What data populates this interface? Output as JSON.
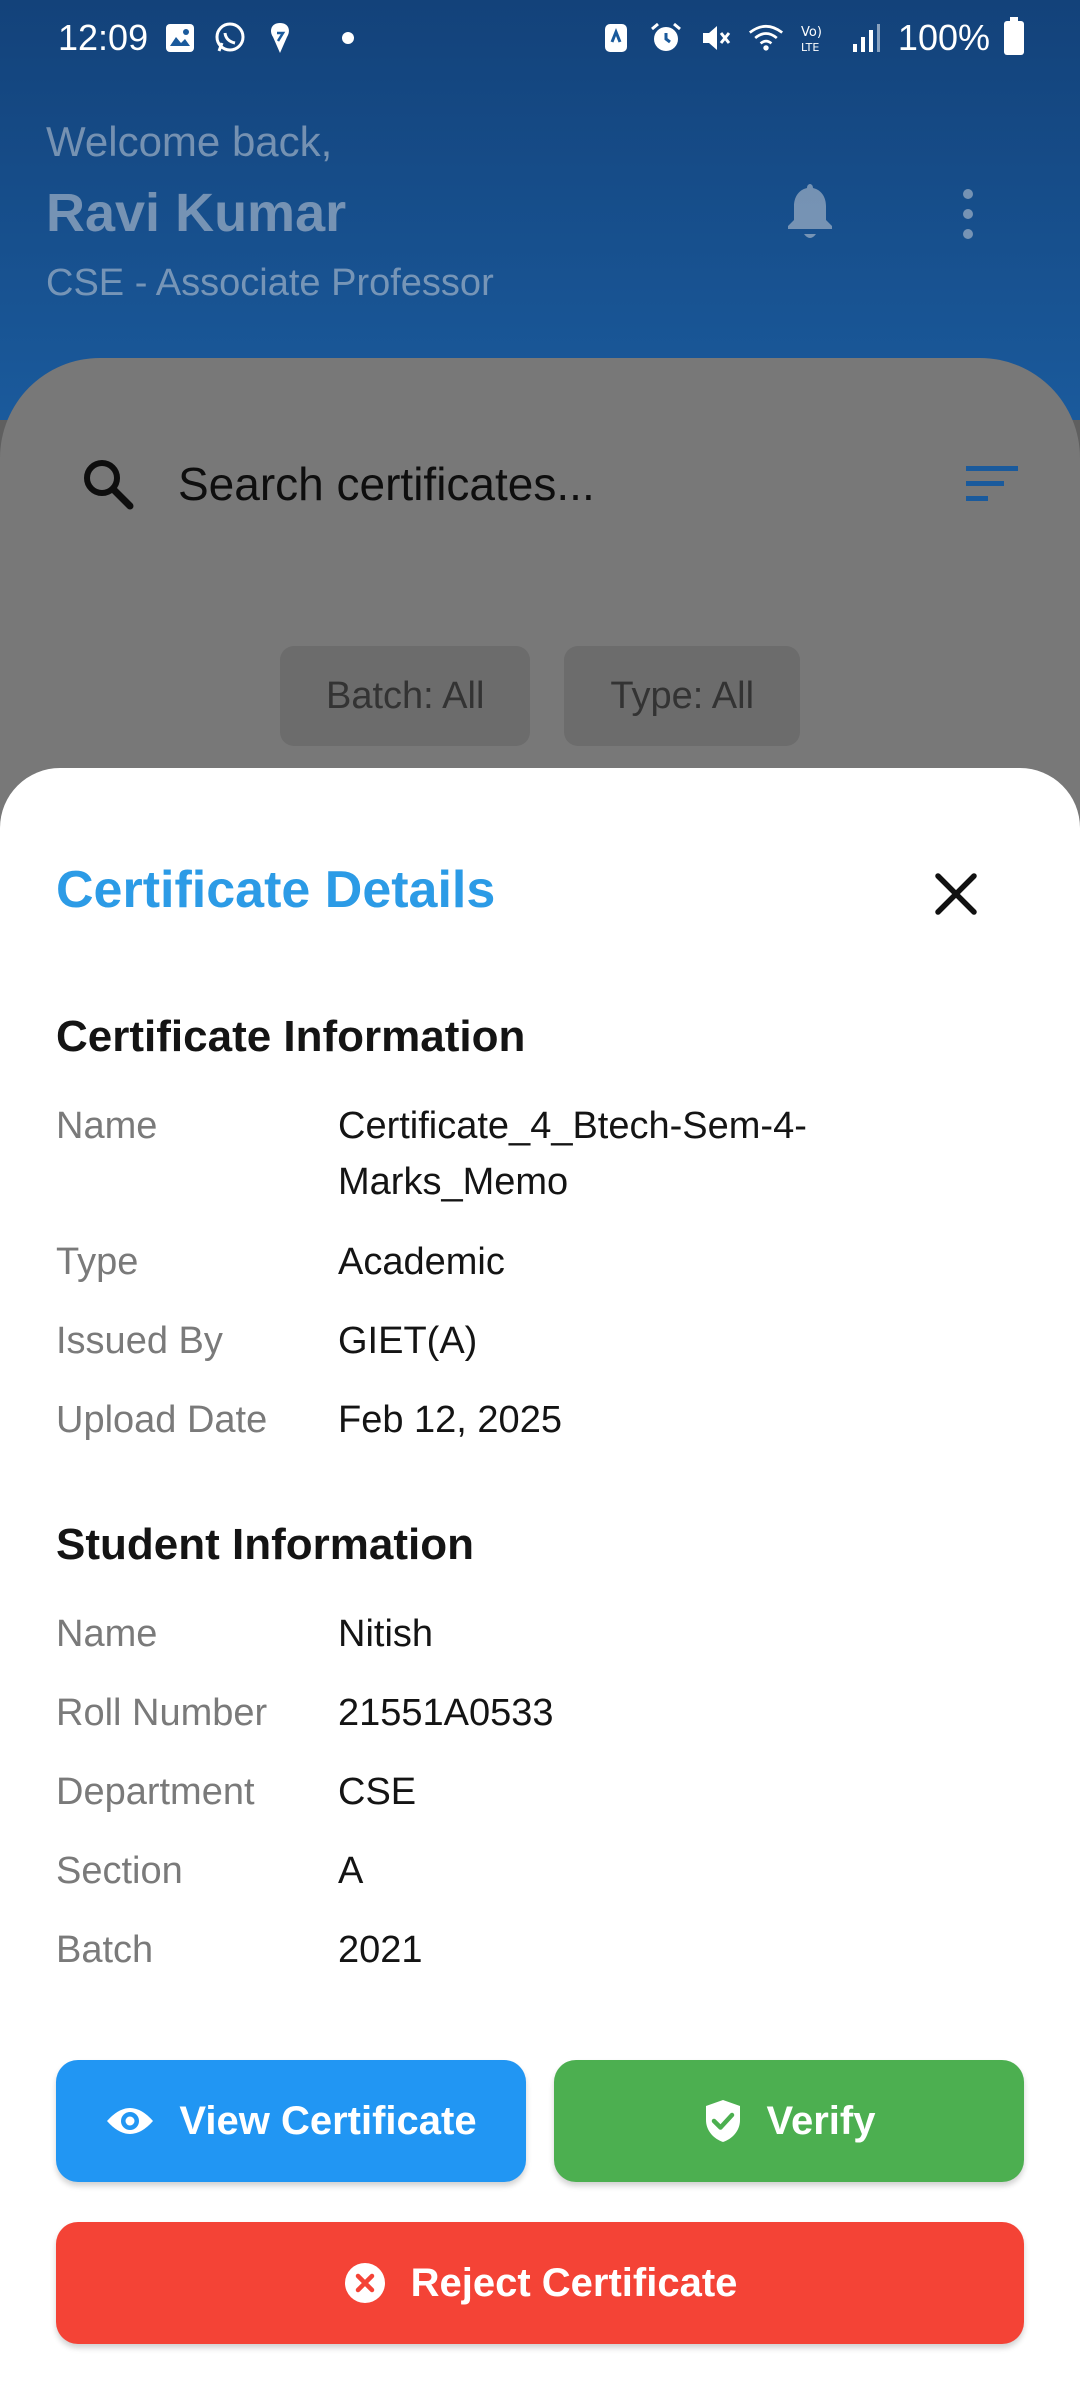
{
  "status_bar": {
    "time": "12:09",
    "battery": "100%",
    "left_icons": [
      "gallery-icon",
      "whatsapp-icon",
      "app-icon",
      "dot-icon"
    ],
    "right_icons": [
      "nfc-icon",
      "alarm-icon",
      "mute-icon",
      "wifi-icon",
      "volte-icon",
      "signal-icon",
      "battery-icon"
    ]
  },
  "header": {
    "greeting": "Welcome back,",
    "user_name": "Ravi Kumar",
    "user_role": "CSE - Associate Professor"
  },
  "search": {
    "placeholder": "Search certificates..."
  },
  "filters": {
    "batch_label": "Batch: All",
    "type_label": "Type: All"
  },
  "sheet": {
    "title": "Certificate Details",
    "certificate_section": {
      "title": "Certificate Information",
      "rows": [
        {
          "label": "Name",
          "value": "Certificate_4_Btech-Sem-4-Marks_Memo"
        },
        {
          "label": "Type",
          "value": "Academic"
        },
        {
          "label": "Issued By",
          "value": "GIET(A)"
        },
        {
          "label": "Upload Date",
          "value": "Feb 12, 2025"
        }
      ]
    },
    "student_section": {
      "title": "Student Information",
      "rows": [
        {
          "label": "Name",
          "value": "Nitish"
        },
        {
          "label": "Roll Number",
          "value": "21551A0533"
        },
        {
          "label": "Department",
          "value": "CSE"
        },
        {
          "label": "Section",
          "value": "A"
        },
        {
          "label": "Batch",
          "value": "2021"
        }
      ]
    },
    "actions": {
      "view_label": "View Certificate",
      "verify_label": "Verify",
      "reject_label": "Reject Certificate"
    }
  },
  "colors": {
    "header_bg": "#1a5a9c",
    "sheet_title": "#2c9be6",
    "view_button": "#2196f3",
    "verify_button": "#4caf50",
    "reject_button": "#f44336",
    "filter_icon": "#1a5a9c"
  }
}
